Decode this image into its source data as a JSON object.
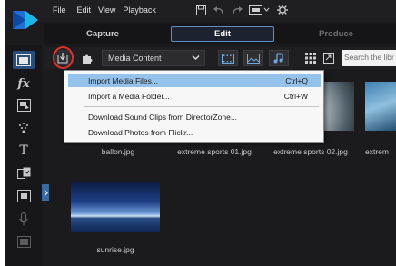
{
  "menubar": {
    "items": [
      "File",
      "Edit",
      "View",
      "Playback"
    ]
  },
  "modes": {
    "capture": "Capture",
    "edit": "Edit",
    "produce": "Produce"
  },
  "toolbar": {
    "media_select": "Media Content",
    "search_placeholder": "Search the libr"
  },
  "import_menu": {
    "items": [
      {
        "label": "Import Media Files...",
        "shortcut": "Ctrl+Q"
      },
      {
        "label": "Import a Media Folder...",
        "shortcut": "Ctrl+W"
      },
      {
        "label": "Download Sound Clips from DirectorZone...",
        "shortcut": ""
      },
      {
        "label": "Download Photos from Flickr...",
        "shortcut": ""
      }
    ]
  },
  "library": {
    "items": [
      {
        "caption": "ballon.jpg"
      },
      {
        "caption": "extreme sports 01.jpg"
      },
      {
        "caption": "extreme sports 02.jpg"
      },
      {
        "caption": "extrem"
      },
      {
        "caption": "sunrise.jpg"
      }
    ]
  },
  "colors": {
    "accent": "#25507e",
    "highlight": "#95c2ea",
    "annotation_ring": "#e0302a"
  }
}
